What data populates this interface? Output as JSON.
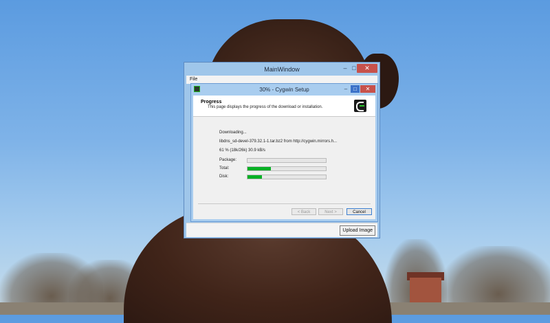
{
  "main_window": {
    "title": "MainWindow",
    "menu": {
      "file_label": "File"
    },
    "controls": {
      "minimize": "–",
      "maximize": "□",
      "close": "✕"
    },
    "upload_label": "Upload Image"
  },
  "dialog": {
    "title": "30% - Cygwin Setup",
    "controls": {
      "minimize": "–",
      "maximize": "□",
      "close": "✕"
    },
    "header": {
      "title": "Progress",
      "subtitle": "This page displays the progress of the download or installation."
    },
    "status": "Downloading...",
    "file_line": "libdns_sd-devel-379.32.1-1.tar.bz2 from http://cygwin.mirrors.h...",
    "stats_line": "61 %  (18k/26k)  30.9 kB/s",
    "progress": [
      {
        "label": "Package:",
        "fraction": 0.0
      },
      {
        "label": "Total:",
        "fraction": 0.3
      },
      {
        "label": "Disk:",
        "fraction": 0.18
      }
    ],
    "buttons": {
      "back": "< Back",
      "next": "Next >",
      "cancel": "Cancel"
    }
  },
  "colors": {
    "progress_fill": "#06b025",
    "close_button": "#c7514b",
    "window_frame": "#9fc6ea"
  }
}
